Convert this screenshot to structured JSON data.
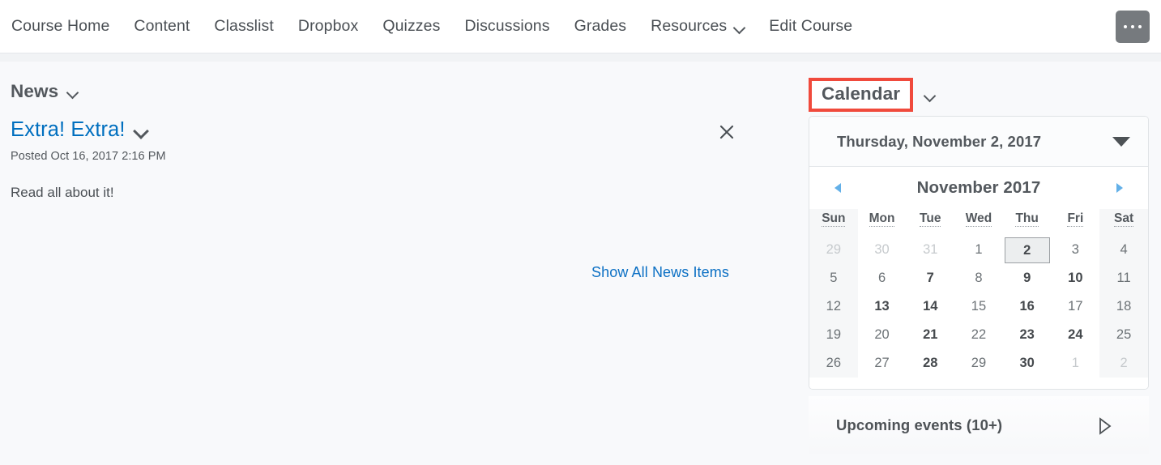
{
  "nav": {
    "items": [
      {
        "label": "Course Home",
        "caret": false,
        "icon": ""
      },
      {
        "label": "Content",
        "caret": false,
        "icon": ""
      },
      {
        "label": "Classlist",
        "caret": false,
        "icon": ""
      },
      {
        "label": "Dropbox",
        "caret": false,
        "icon": ""
      },
      {
        "label": "Quizzes",
        "caret": false,
        "icon": ""
      },
      {
        "label": "Discussions",
        "caret": false,
        "icon": ""
      },
      {
        "label": "Grades",
        "caret": false,
        "icon": ""
      },
      {
        "label": "Resources",
        "caret": true,
        "icon": "chevron-down-icon"
      },
      {
        "label": "Edit Course",
        "caret": false,
        "icon": ""
      }
    ],
    "more_button": {
      "icon": "ellipsis-icon",
      "label": ""
    }
  },
  "news": {
    "title": "News",
    "caret_icon": "chevron-down-icon",
    "item": {
      "title": "Extra! Extra!",
      "caret_icon": "chevron-down-icon",
      "posted": "Posted Oct 16, 2017 2:16 PM",
      "body": "Read all about it!",
      "close_icon": "close-icon"
    },
    "show_all_label": "Show All News Items"
  },
  "calendar": {
    "title": "Calendar",
    "caret_icon": "chevron-down-icon",
    "highlight_color": "#f04a3c",
    "selected_date_label": "Thursday, November 2, 2017",
    "date_dropdown_icon": "triangle-down-icon",
    "month_label": "November 2017",
    "prev_icon": "arrow-left-icon",
    "next_icon": "arrow-right-icon",
    "day_headers": [
      "Sun",
      "Mon",
      "Tue",
      "Wed",
      "Thu",
      "Fri",
      "Sat"
    ],
    "weeks": [
      [
        {
          "d": "29",
          "out": true,
          "ev": false,
          "sel": false
        },
        {
          "d": "30",
          "out": true,
          "ev": false,
          "sel": false
        },
        {
          "d": "31",
          "out": true,
          "ev": false,
          "sel": false
        },
        {
          "d": "1",
          "out": false,
          "ev": false,
          "sel": false
        },
        {
          "d": "2",
          "out": false,
          "ev": false,
          "sel": true
        },
        {
          "d": "3",
          "out": false,
          "ev": false,
          "sel": false
        },
        {
          "d": "4",
          "out": false,
          "ev": false,
          "sel": false
        }
      ],
      [
        {
          "d": "5",
          "out": false,
          "ev": false,
          "sel": false
        },
        {
          "d": "6",
          "out": false,
          "ev": false,
          "sel": false
        },
        {
          "d": "7",
          "out": false,
          "ev": true,
          "sel": false
        },
        {
          "d": "8",
          "out": false,
          "ev": false,
          "sel": false
        },
        {
          "d": "9",
          "out": false,
          "ev": true,
          "sel": false
        },
        {
          "d": "10",
          "out": false,
          "ev": true,
          "sel": false
        },
        {
          "d": "11",
          "out": false,
          "ev": false,
          "sel": false
        }
      ],
      [
        {
          "d": "12",
          "out": false,
          "ev": false,
          "sel": false
        },
        {
          "d": "13",
          "out": false,
          "ev": true,
          "sel": false
        },
        {
          "d": "14",
          "out": false,
          "ev": true,
          "sel": false
        },
        {
          "d": "15",
          "out": false,
          "ev": false,
          "sel": false
        },
        {
          "d": "16",
          "out": false,
          "ev": true,
          "sel": false
        },
        {
          "d": "17",
          "out": false,
          "ev": false,
          "sel": false
        },
        {
          "d": "18",
          "out": false,
          "ev": false,
          "sel": false
        }
      ],
      [
        {
          "d": "19",
          "out": false,
          "ev": false,
          "sel": false
        },
        {
          "d": "20",
          "out": false,
          "ev": false,
          "sel": false
        },
        {
          "d": "21",
          "out": false,
          "ev": true,
          "sel": false
        },
        {
          "d": "22",
          "out": false,
          "ev": false,
          "sel": false
        },
        {
          "d": "23",
          "out": false,
          "ev": true,
          "sel": false
        },
        {
          "d": "24",
          "out": false,
          "ev": true,
          "sel": false
        },
        {
          "d": "25",
          "out": false,
          "ev": false,
          "sel": false
        }
      ],
      [
        {
          "d": "26",
          "out": false,
          "ev": false,
          "sel": false
        },
        {
          "d": "27",
          "out": false,
          "ev": false,
          "sel": false
        },
        {
          "d": "28",
          "out": false,
          "ev": true,
          "sel": false
        },
        {
          "d": "29",
          "out": false,
          "ev": false,
          "sel": false
        },
        {
          "d": "30",
          "out": false,
          "ev": true,
          "sel": false
        },
        {
          "d": "1",
          "out": true,
          "ev": false,
          "sel": false
        },
        {
          "d": "2",
          "out": true,
          "ev": false,
          "sel": false
        }
      ]
    ],
    "upcoming_events_label": "Upcoming events (10+)",
    "upcoming_events_icon": "triangle-right-icon"
  }
}
